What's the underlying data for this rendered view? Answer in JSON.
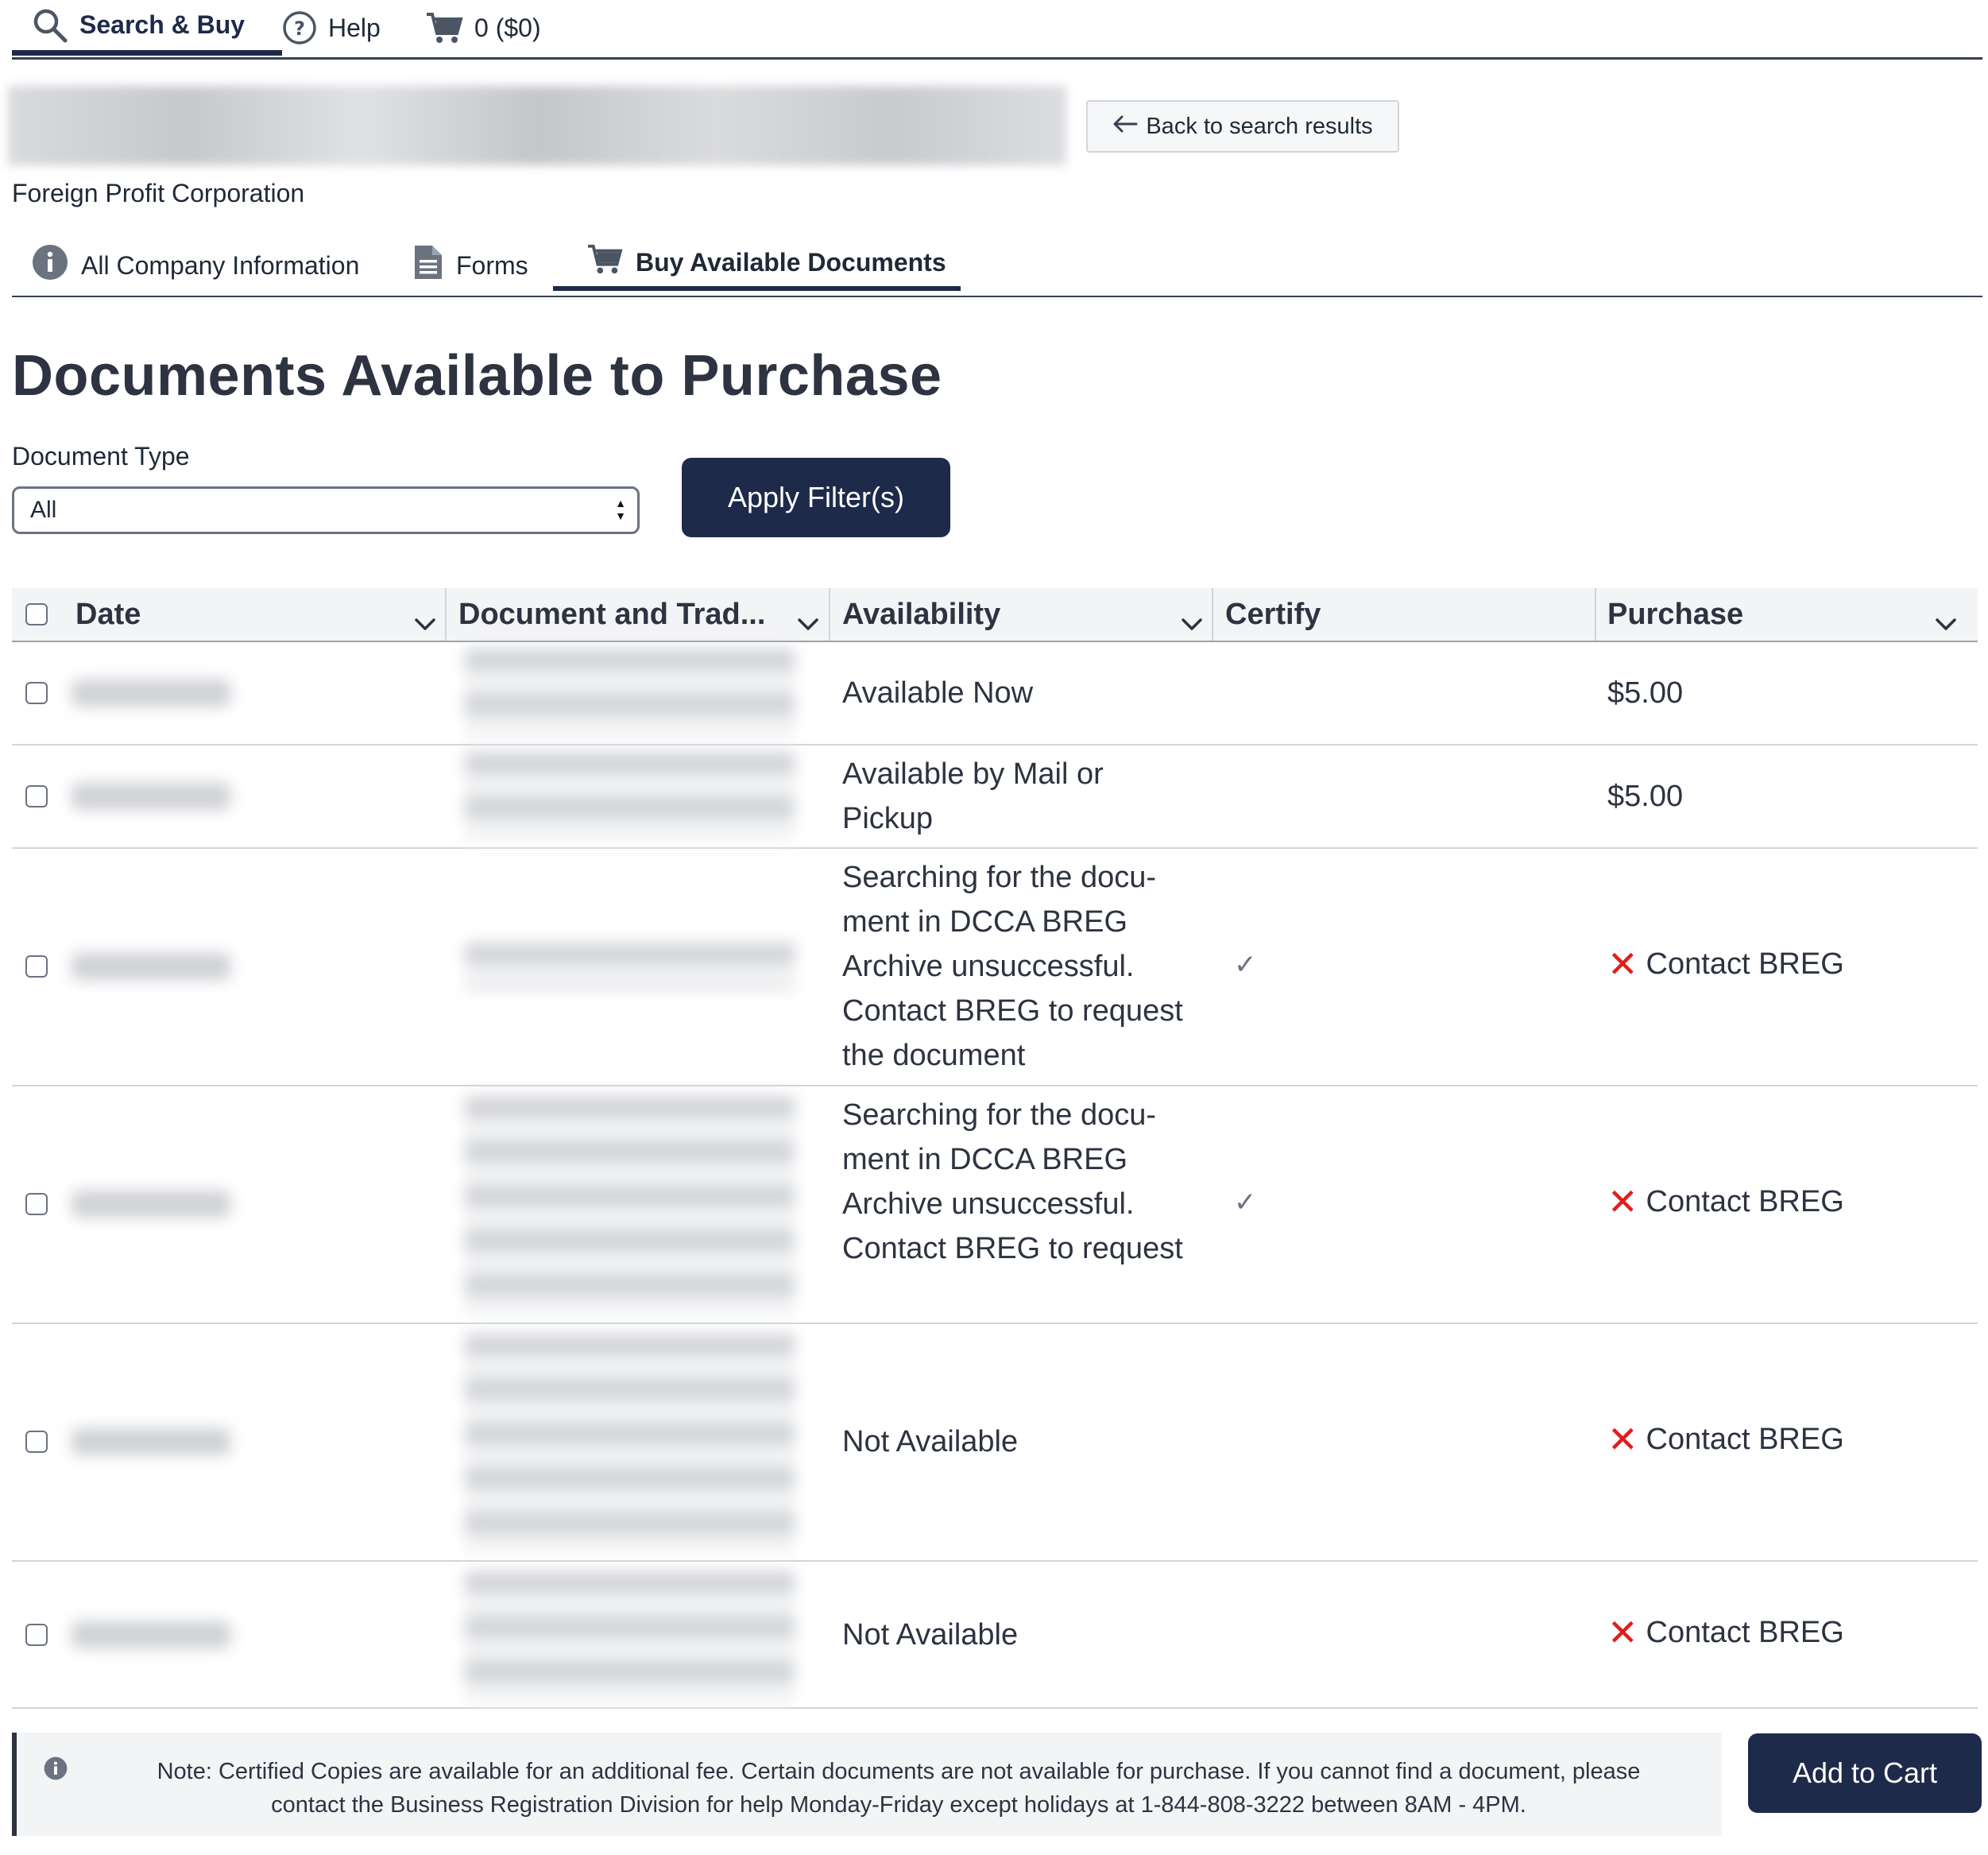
{
  "nav": {
    "search_buy": "Search & Buy",
    "help": "Help",
    "cart": "0 ($0)"
  },
  "company": {
    "back_label": "Back to search results",
    "entity_type": "Foreign Profit Corporation"
  },
  "tabs": {
    "all_info": "All Company Information",
    "forms": "Forms",
    "buy_docs": "Buy Available Documents"
  },
  "page_title": "Documents Available to Purchase",
  "filter": {
    "label": "Document Type",
    "selected": "All",
    "apply_label": "Apply Filter(s)"
  },
  "table": {
    "headers": {
      "date": "Date",
      "document": "Document and Trad...",
      "availability": "Availability",
      "certify": "Certify",
      "purchase": "Purchase"
    },
    "rows": [
      {
        "availability": [
          "Available Now"
        ],
        "certify": "",
        "purchase": "$5.00",
        "contact": false
      },
      {
        "availability": [
          "Available by Mail or",
          "Pickup"
        ],
        "certify": "",
        "purchase": "$5.00",
        "contact": false
      },
      {
        "availability": [
          "Searching for the docu-",
          "ment in DCCA BREG",
          "Archive unsuccessful.",
          "Contact BREG to request",
          "the document"
        ],
        "certify": "✓",
        "purchase": "Contact BREG",
        "contact": true
      },
      {
        "availability": [
          "Searching for the docu-",
          "ment in DCCA BREG",
          "Archive unsuccessful.",
          "Contact BREG to request"
        ],
        "certify": "✓",
        "purchase": "Contact BREG",
        "contact": true
      },
      {
        "availability": [
          "Not Available"
        ],
        "certify": "",
        "purchase": "Contact BREG",
        "contact": true
      },
      {
        "availability": [
          "Not Available"
        ],
        "certify": "",
        "purchase": "Contact BREG",
        "contact": true
      }
    ]
  },
  "note": {
    "line1": "Note: Certified Copies are available for an additional fee. Certain documents are not available for purchase. If you cannot find a document, please",
    "line2": "contact the Business Registration Division for help Monday-Friday except holidays at 1-844-808-3222 between 8AM - 4PM."
  },
  "add_to_cart": "Add to Cart",
  "colors": {
    "primary": "#1e2a4a",
    "error": "#e11d1d"
  }
}
